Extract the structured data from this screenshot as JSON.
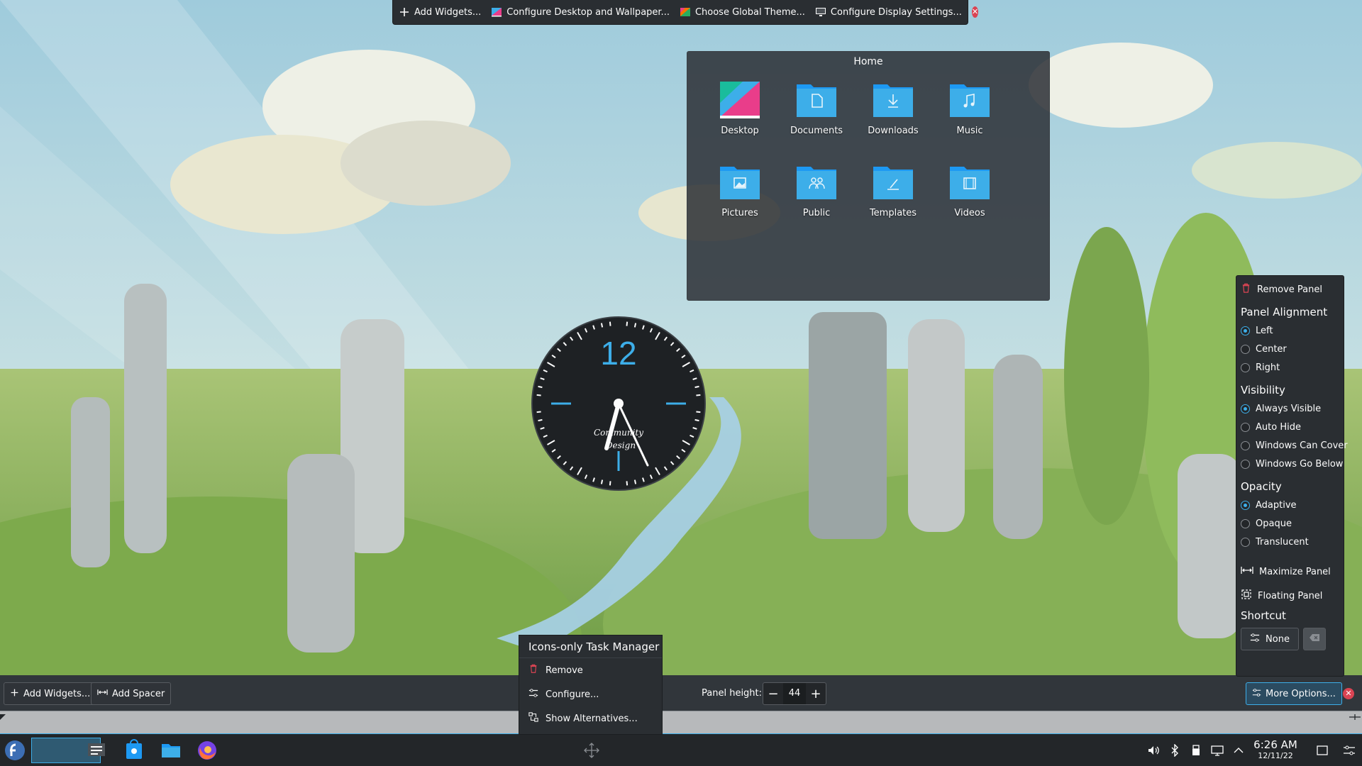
{
  "desktop_toolbar": {
    "add_widgets": "Add Widgets...",
    "configure_desktop": "Configure Desktop and Wallpaper...",
    "choose_theme": "Choose Global Theme...",
    "configure_display": "Configure Display Settings..."
  },
  "folder_view": {
    "title": "Home",
    "items": [
      "Desktop",
      "Documents",
      "Downloads",
      "Music",
      "Pictures",
      "Public",
      "Templates",
      "Videos"
    ]
  },
  "clock": {
    "twelve": "12",
    "brand_line1": "Community",
    "brand_line2": "Design"
  },
  "panel_options": {
    "remove_panel": "Remove Panel",
    "alignment_heading": "Panel Alignment",
    "alignment_options": [
      "Left",
      "Center",
      "Right"
    ],
    "alignment_selected": "Left",
    "visibility_heading": "Visibility",
    "visibility_options": [
      "Always Visible",
      "Auto Hide",
      "Windows Can Cover",
      "Windows Go Below"
    ],
    "visibility_selected": "Always Visible",
    "opacity_heading": "Opacity",
    "opacity_options": [
      "Adaptive",
      "Opaque",
      "Translucent"
    ],
    "opacity_selected": "Adaptive",
    "maximize_panel": "Maximize Panel",
    "floating_panel": "Floating Panel",
    "shortcut_heading": "Shortcut",
    "shortcut_value": "None"
  },
  "edit_bar": {
    "add_widgets": "Add Widgets...",
    "add_spacer": "Add Spacer",
    "panel_height_label": "Panel height:",
    "panel_height_value": "44",
    "more_options": "More Options..."
  },
  "context_menu": {
    "title": "Icons-only Task Manager",
    "remove": "Remove",
    "configure": "Configure...",
    "show_alternatives": "Show Alternatives..."
  },
  "taskbar": {
    "time": "6:26 AM",
    "date": "12/11/22"
  },
  "colors": {
    "accent": "#3daee9",
    "panel_bg": "#2a2e32",
    "danger": "#da4453",
    "folder_blue": "#3daee9"
  }
}
